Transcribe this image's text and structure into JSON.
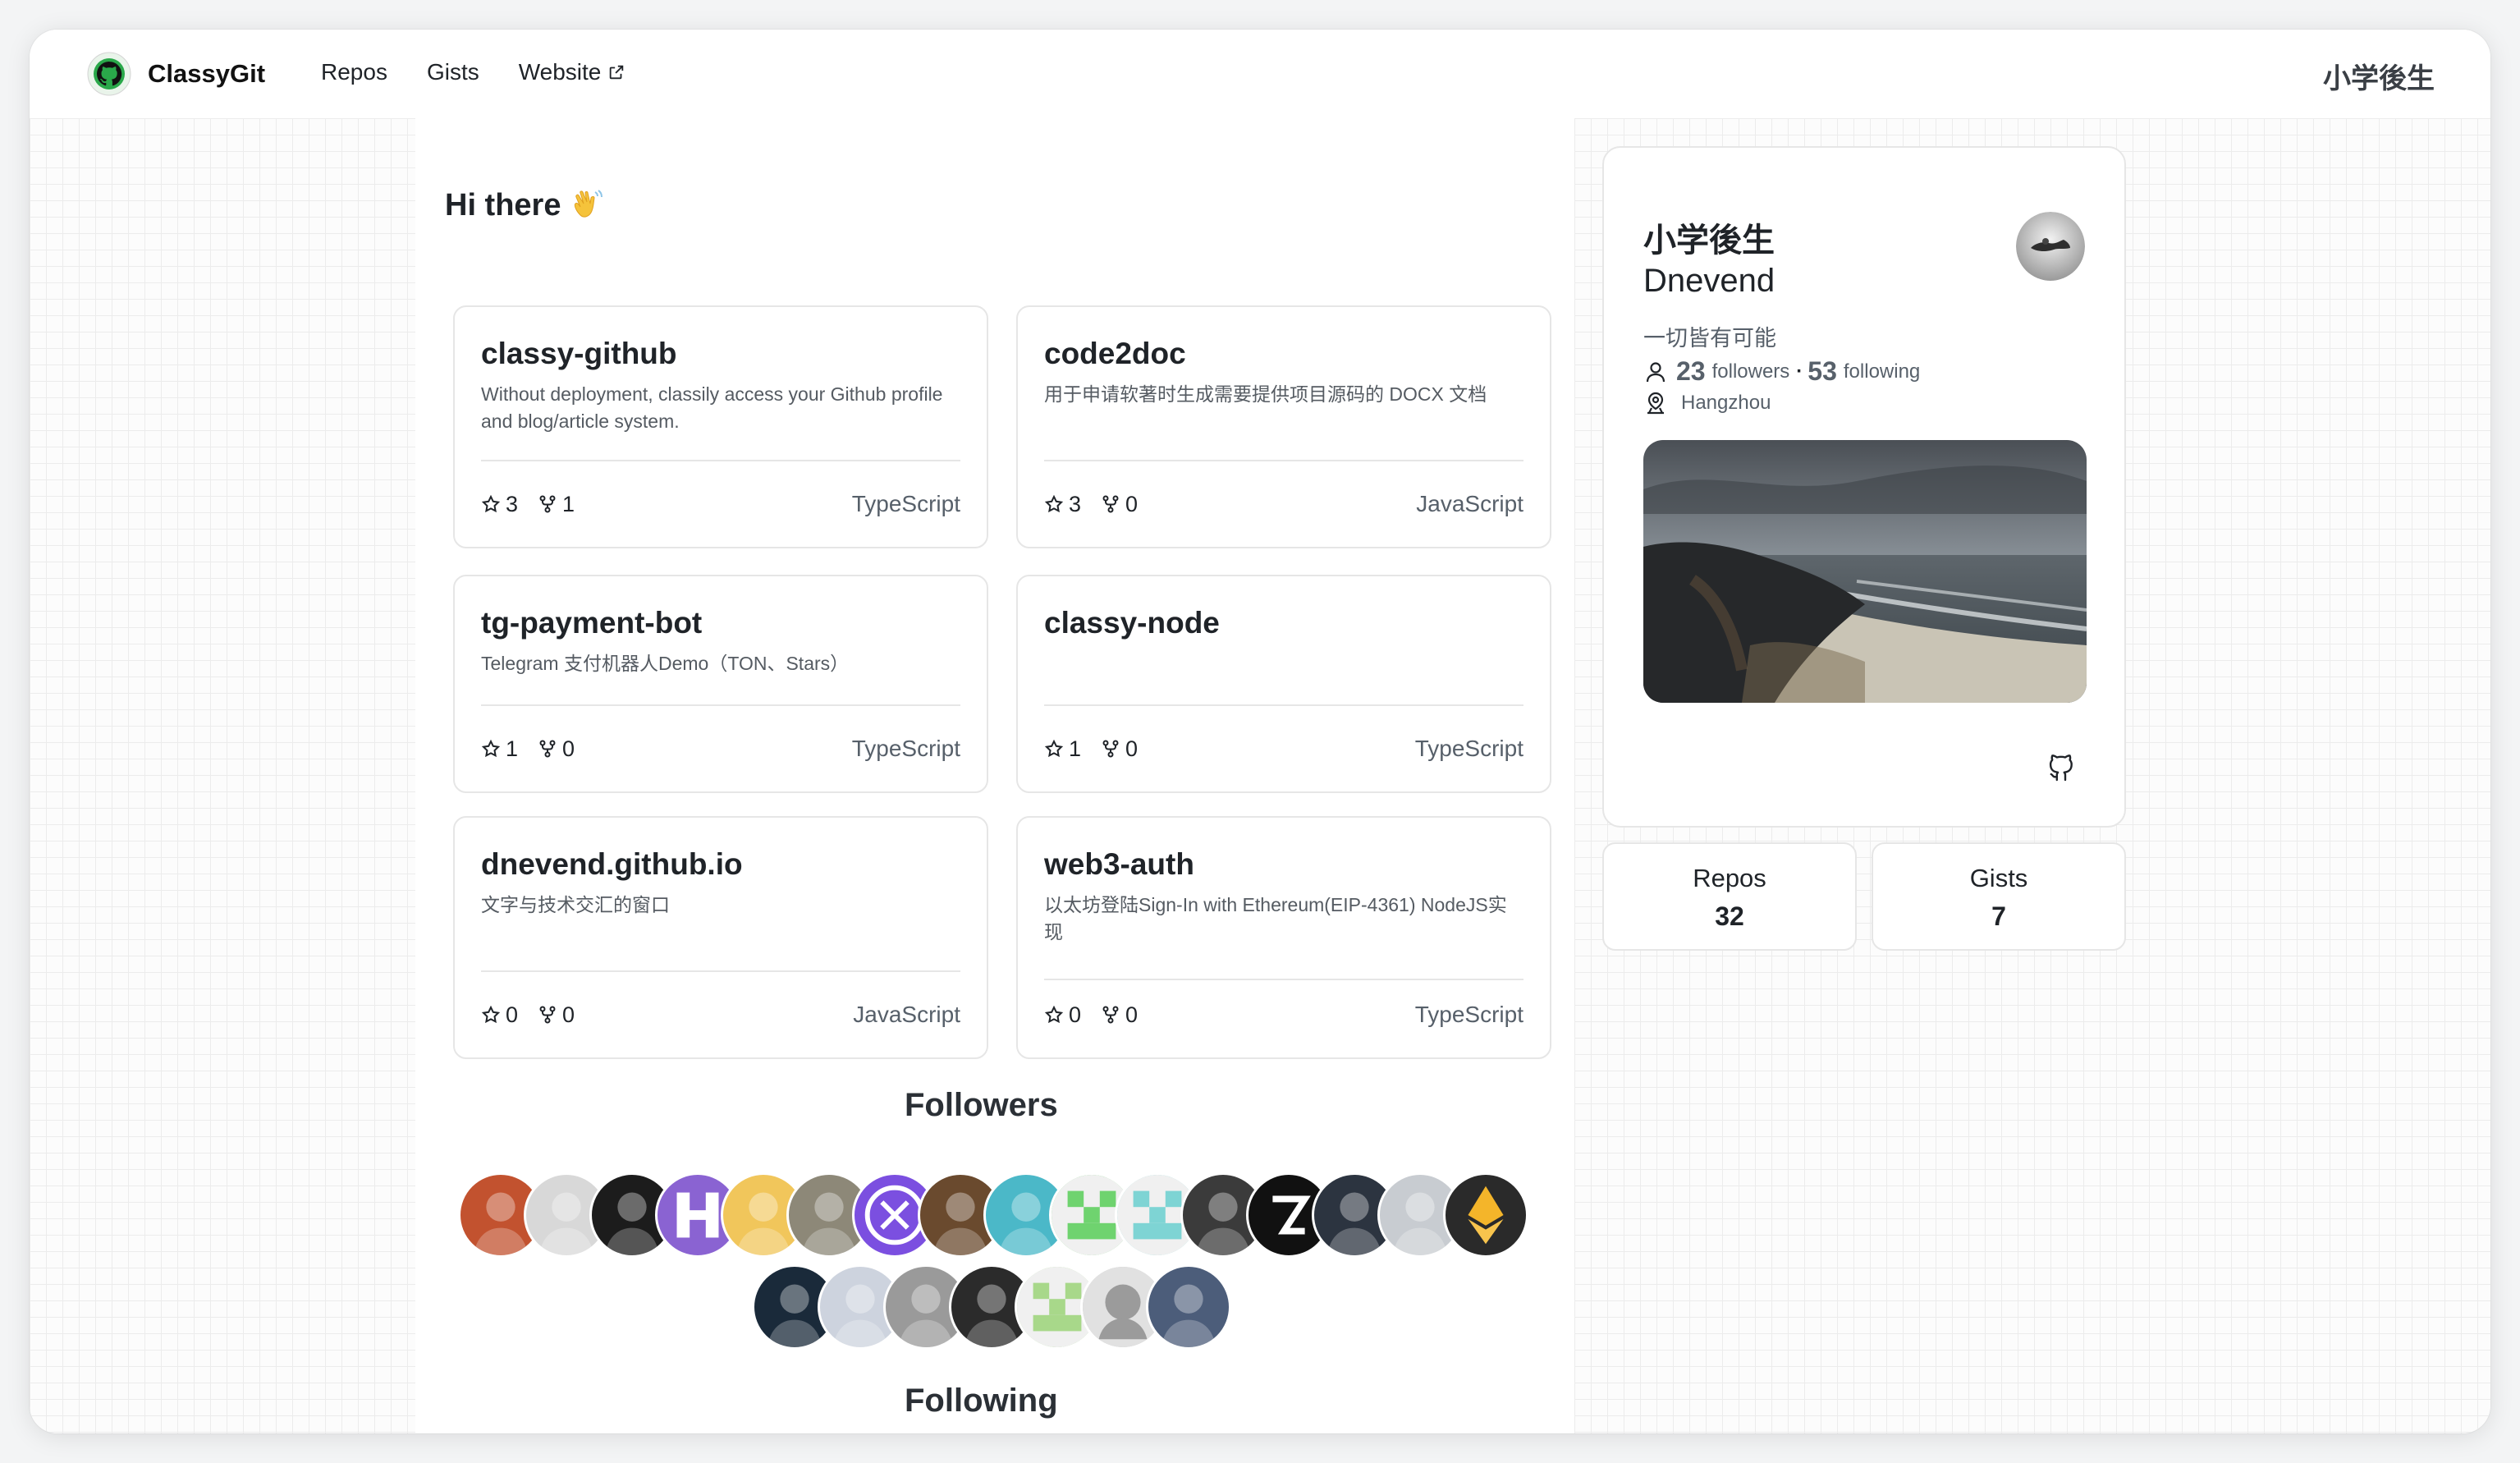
{
  "header": {
    "brand": "ClassyGit",
    "nav": [
      "Repos",
      "Gists",
      "Website"
    ],
    "user_name": "小学後生"
  },
  "greeting": "Hi there",
  "repos": [
    {
      "name": "classy-github",
      "desc": "Without deployment, classily access your Github profile and blog/article system.",
      "stars": "3",
      "forks": "1",
      "lang": "TypeScript"
    },
    {
      "name": "code2doc",
      "desc": "用于申请软著时生成需要提供项目源码的 DOCX 文档",
      "stars": "3",
      "forks": "0",
      "lang": "JavaScript"
    },
    {
      "name": "tg-payment-bot",
      "desc": "Telegram 支付机器人Demo（TON、Stars）",
      "stars": "1",
      "forks": "0",
      "lang": "TypeScript"
    },
    {
      "name": "classy-node",
      "desc": "",
      "stars": "1",
      "forks": "0",
      "lang": "TypeScript"
    },
    {
      "name": "dnevend.github.io",
      "desc": "文字与技术交汇的窗口",
      "stars": "0",
      "forks": "0",
      "lang": "JavaScript"
    },
    {
      "name": "web3-auth",
      "desc": "以太坊登陆Sign-In with Ethereum(EIP-4361) NodeJS实现",
      "stars": "0",
      "forks": "0",
      "lang": "TypeScript"
    }
  ],
  "followers_title": "Followers",
  "following_title": "Following",
  "followers": [
    {
      "icon": "avatar-cartoon-icon",
      "color": "#c2522f"
    },
    {
      "icon": "avatar-photo-icon",
      "color": "#d8d8d8"
    },
    {
      "icon": "avatar-photo-icon",
      "color": "#1c1c1c"
    },
    {
      "icon": "avatar-h-logo-icon",
      "color": "#8a63d2"
    },
    {
      "icon": "avatar-anime-icon",
      "color": "#f1c65b"
    },
    {
      "icon": "avatar-photo-icon",
      "color": "#8d8878"
    },
    {
      "icon": "avatar-x-logo-icon",
      "color": "#7b4fe0"
    },
    {
      "icon": "avatar-coin-icon",
      "color": "#6a4a2e"
    },
    {
      "icon": "avatar-anime-icon",
      "color": "#4bb8c8"
    },
    {
      "icon": "avatar-identicon-icon",
      "color": "#6fd36f"
    },
    {
      "icon": "avatar-identicon-icon",
      "color": "#7ed4d4"
    },
    {
      "icon": "avatar-photo-icon",
      "color": "#3b3b3b"
    },
    {
      "icon": "avatar-s-logo-icon",
      "color": "#111111"
    },
    {
      "icon": "avatar-photo-icon",
      "color": "#2c3440"
    },
    {
      "icon": "avatar-photo-icon",
      "color": "#c8ccd1"
    },
    {
      "icon": "avatar-eth-icon",
      "color": "#2a2a2a"
    },
    {
      "icon": "avatar-photo-icon",
      "color": "#1a2a3a"
    },
    {
      "icon": "avatar-photo-icon",
      "color": "#cdd3de"
    },
    {
      "icon": "avatar-statue-icon",
      "color": "#9a9a9a"
    },
    {
      "icon": "avatar-photo-icon",
      "color": "#2b2b2b"
    },
    {
      "icon": "avatar-identicon-icon",
      "color": "#a8d88a"
    },
    {
      "icon": "avatar-github-default-icon",
      "color": "#c9c9c9"
    },
    {
      "icon": "avatar-photo-icon",
      "color": "#4c5d7a"
    }
  ],
  "profile": {
    "name": "小学後生",
    "login": "Dnevend",
    "bio": "一切皆有可能",
    "followers": "23",
    "followers_label": "followers",
    "separator": "·",
    "following": "53",
    "following_label": "following",
    "location": "Hangzhou"
  },
  "stats": [
    {
      "label": "Repos",
      "value": "32"
    },
    {
      "label": "Gists",
      "value": "7"
    }
  ]
}
